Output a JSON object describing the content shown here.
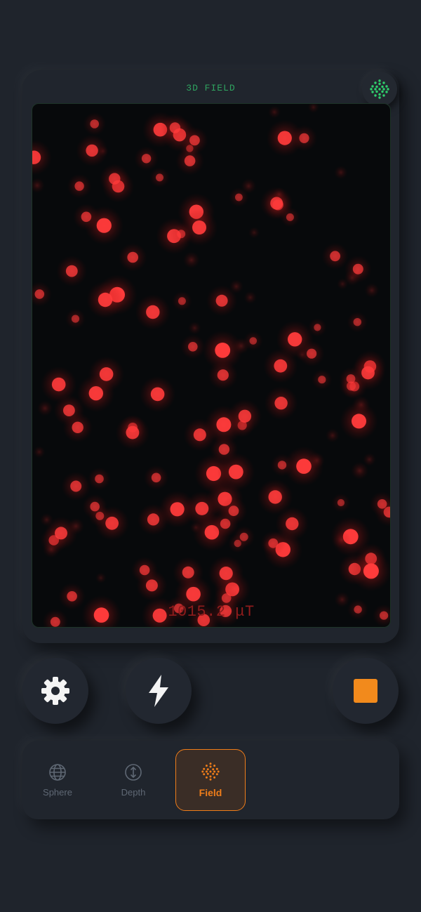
{
  "panel": {
    "title": "3D FIELD",
    "readout": "1015.2 μT"
  },
  "colors": {
    "accent": "#ef7d1a",
    "field_particle": "#ff3b3b",
    "title_green": "#2fa460",
    "background": "#1f242c"
  },
  "controls": {
    "settings_icon": "gear-icon",
    "power_icon": "lightning-icon",
    "stop_icon": "stop-square-icon",
    "mode_icon": "dot-grid-icon"
  },
  "tabs": [
    {
      "label": "Sphere",
      "icon": "globe-icon",
      "active": false
    },
    {
      "label": "Depth",
      "icon": "depth-arrows-icon",
      "active": false
    },
    {
      "label": "Field",
      "icon": "dot-grid-icon",
      "active": true
    }
  ]
}
